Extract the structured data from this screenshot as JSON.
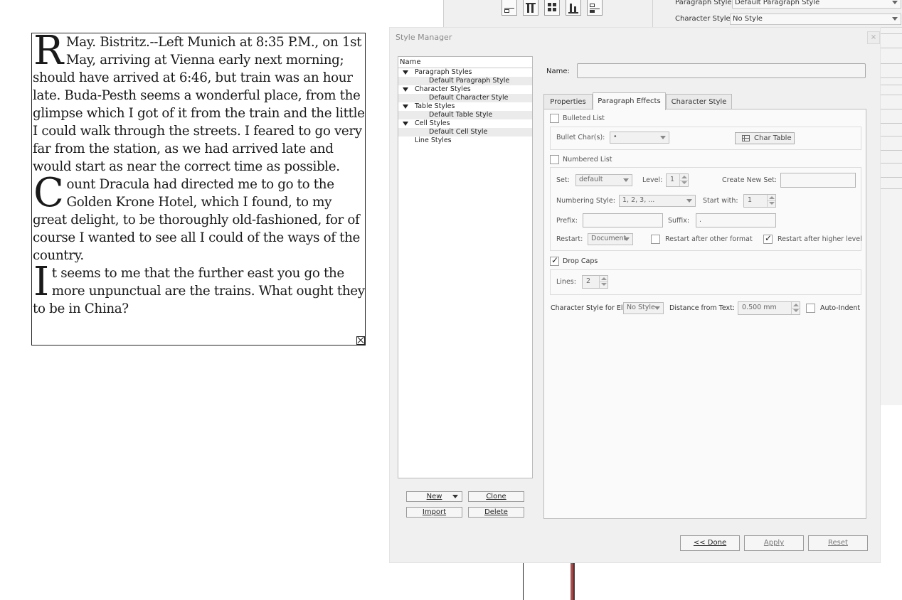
{
  "document": {
    "paragraphs": [
      {
        "dropcap": "R",
        "text": "May. Bistritz.--Left Munich at 8:35 P.M., on 1st May, arriving at Vienna early next morning; should have arrived at 6:46, but train was an hour late. Buda-Pesth seems a wonderful place, from the glimpse which I got of it from the train and the little I could walk through the streets. I feared to go very far from the station, as we had arrived late and would start as near the correct time as possible."
      },
      {
        "dropcap": "C",
        "text": "ount Dracula had directed me to go to the Golden Krone Hotel, which I found, to my great delight, to be thoroughly old-fashioned, for of course I wanted to see all I could of the ways of the country."
      },
      {
        "dropcap": "I",
        "text": "t seems to me that the further east you go the more unpunctual are the trains. What ought they to be in China?"
      }
    ]
  },
  "background_panel": {
    "paragraph_style_label": "Paragraph Style:",
    "paragraph_style_value": "Default Paragraph Style",
    "character_style_label": "Character Style:",
    "character_style_value": "No Style"
  },
  "dialog": {
    "title": "Style Manager",
    "close_glyph": "×",
    "tree": {
      "header": "Name",
      "rows": [
        {
          "kind": "cat",
          "label": "Paragraph Styles"
        },
        {
          "kind": "child",
          "label": "Default Paragraph Style"
        },
        {
          "kind": "cat",
          "label": "Character Styles"
        },
        {
          "kind": "child",
          "label": "Default Character Style"
        },
        {
          "kind": "cat",
          "label": "Table Styles"
        },
        {
          "kind": "child",
          "label": "Default Table Style"
        },
        {
          "kind": "cat",
          "label": "Cell Styles"
        },
        {
          "kind": "child",
          "label": "Default Cell Style"
        },
        {
          "kind": "leaf",
          "label": "Line Styles"
        }
      ]
    },
    "buttons": {
      "new": "New",
      "clone": "Clone",
      "import": "Import",
      "delete": "Delete",
      "done": "<< Done",
      "apply": "Apply",
      "reset": "Reset"
    },
    "name_label": "Name:",
    "name_value": "",
    "tabs": [
      "Properties",
      "Paragraph Effects",
      "Character Style"
    ],
    "active_tab": "Paragraph Effects",
    "paragraph_effects": {
      "bulleted_list": {
        "label": "Bulleted List",
        "checked": false
      },
      "bullet_chars_label": "Bullet Char(s):",
      "bullet_chars_value": "•",
      "char_table_label": "Char Table",
      "numbered_list": {
        "label": "Numbered List",
        "checked": false
      },
      "set_label": "Set:",
      "set_value": "default",
      "level_label": "Level:",
      "level_value": "1",
      "create_new_set_label": "Create New Set:",
      "numbering_style_label": "Numbering Style:",
      "numbering_style_value": "1, 2, 3, ...",
      "start_with_label": "Start with:",
      "start_with_value": "1",
      "prefix_label": "Prefix:",
      "prefix_value": "",
      "suffix_label": "Suffix:",
      "suffix_value": ".",
      "restart_label": "Restart:",
      "restart_value": "Document",
      "restart_after_other": {
        "label": "Restart after other format",
        "checked": false
      },
      "restart_after_higher": {
        "label": "Restart after higher level",
        "checked": true
      },
      "drop_caps": {
        "label": "Drop Caps",
        "checked": true
      },
      "lines_label": "Lines:",
      "lines_value": "2",
      "char_style_for_el_label": "Character Style for El",
      "char_style_for_el_value": "No Style",
      "distance_label": "Distance from Text:",
      "distance_value": "0.500 mm",
      "auto_indent": {
        "label": "Auto-Indent",
        "checked": false
      }
    }
  }
}
